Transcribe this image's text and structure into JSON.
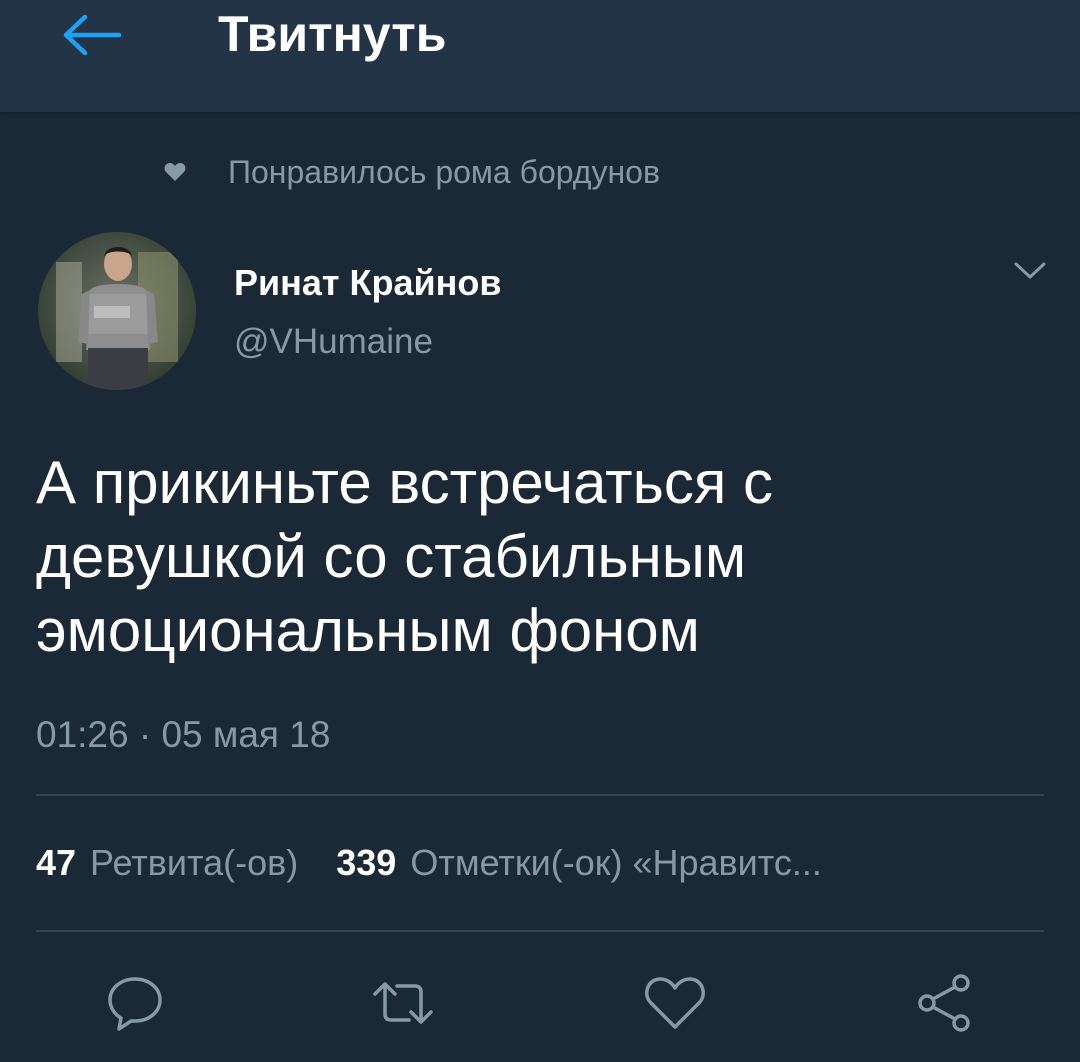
{
  "header": {
    "back_icon": "arrow-left-icon",
    "title": "Твитнуть",
    "accent_color": "#1da1f2"
  },
  "social_context": {
    "icon": "heart-icon",
    "text": "Понравилось рома бордунов"
  },
  "author": {
    "name": "Ринат Крайнов",
    "handle": "@VHumaine",
    "avatar_icon": "avatar-photo"
  },
  "tweet": {
    "text": "А прикиньте встречаться с\nдевушкой со стабильным\nэмоциональным фоном",
    "timestamp": "01:26 · 05 мая 18"
  },
  "stats": {
    "retweets_count": "47",
    "retweets_label": "Ретвита(-ов)",
    "likes_count": "339",
    "likes_label": "Отметки(-ок) «Нравитс..."
  },
  "actions": [
    {
      "icon": "reply-icon"
    },
    {
      "icon": "retweet-icon"
    },
    {
      "icon": "like-icon"
    },
    {
      "icon": "share-icon"
    }
  ],
  "colors": {
    "background": "#1b2836",
    "header_bg": "#243447",
    "secondary_text": "#8899a6",
    "divider": "#38444d"
  }
}
